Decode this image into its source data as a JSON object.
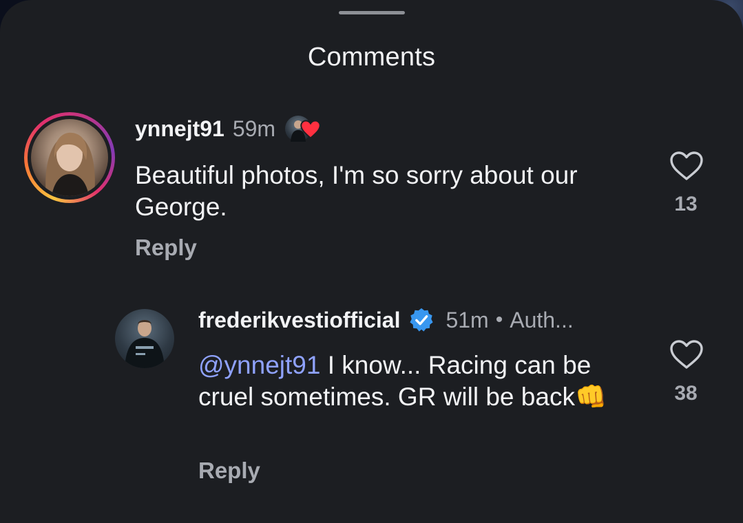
{
  "header": {
    "title": "Comments"
  },
  "comments": [
    {
      "username": "ynnejt91",
      "time": "59m",
      "text": "Beautiful photos, I'm so sorry about our George.",
      "reply_label": "Reply",
      "likes": "13",
      "liked_by_author_icon": "heart-red",
      "has_story_ring": true
    },
    {
      "username": "frederikvestiofficial",
      "verified": true,
      "time": "51m",
      "separator": "•",
      "badge": "Auth...",
      "mention": "@ynnejt91",
      "text": " I know... Racing can be cruel sometimes. GR will be back",
      "emoji": "👊",
      "reply_label": "Reply",
      "likes": "38"
    }
  ],
  "colors": {
    "sheet_bg": "#1c1e22",
    "text_primary": "#f2f3f5",
    "text_secondary": "#a8abb2",
    "mention": "#8fa2ff",
    "verified_blue": "#3897f0",
    "heart_red": "#ff3040"
  }
}
